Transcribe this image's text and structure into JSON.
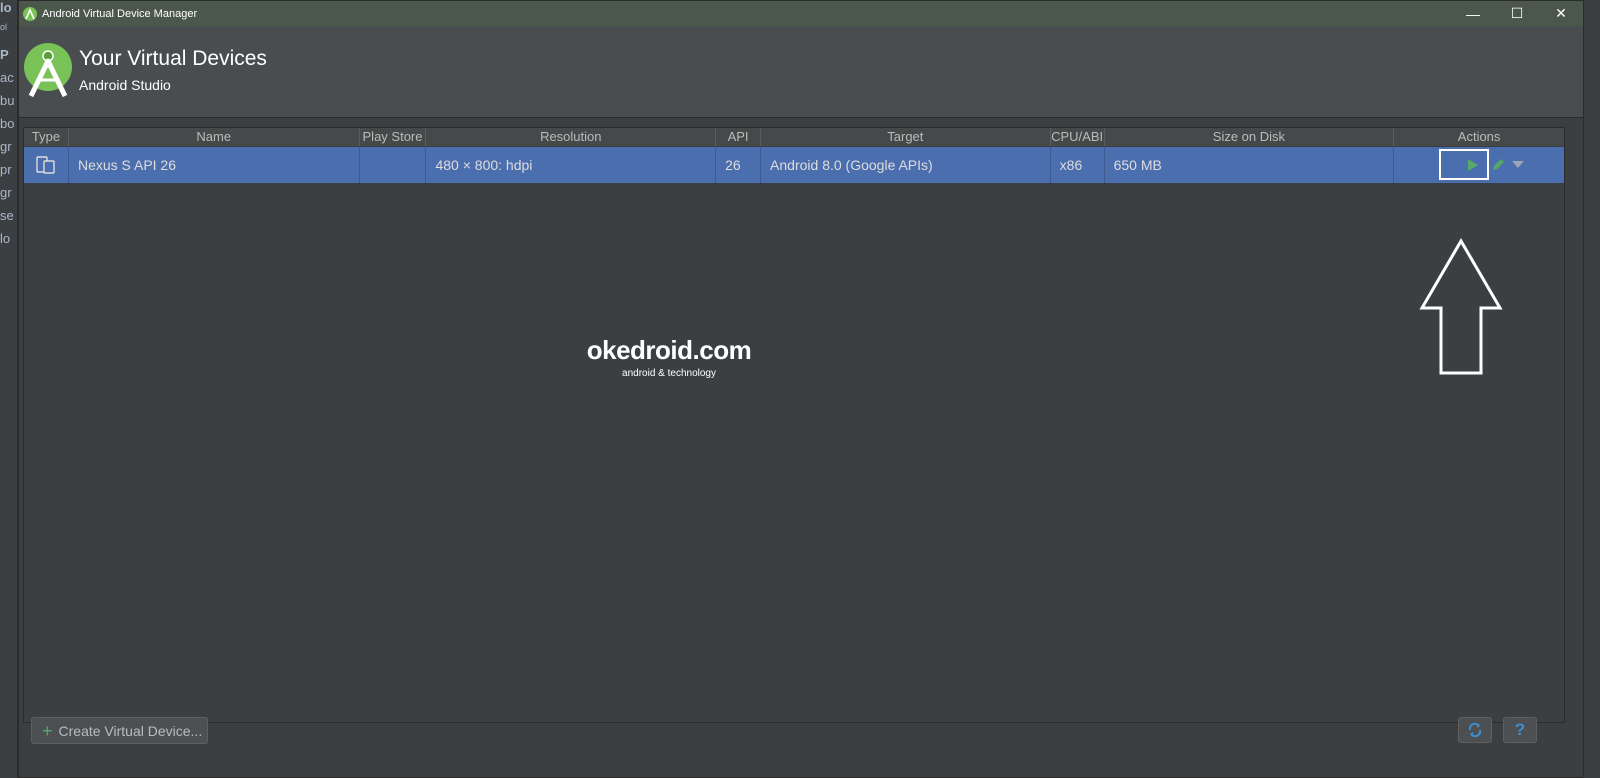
{
  "window": {
    "title": "Android Virtual Device Manager",
    "controls": {
      "minimize": "—",
      "maximize": "☐",
      "close": "✕"
    }
  },
  "background_ide": {
    "fragments": [
      "lo",
      "ol",
      "P",
      "ac",
      "bu",
      "bo",
      "gr",
      "pr",
      "gr",
      "se",
      "lo"
    ]
  },
  "header": {
    "title": "Your Virtual Devices",
    "subtitle": "Android Studio",
    "logo_icon": "android-studio-logo-icon"
  },
  "table": {
    "columns": [
      "Type",
      "Name",
      "Play Store",
      "Resolution",
      "API",
      "Target",
      "CPU/ABI",
      "Size on Disk",
      "Actions"
    ],
    "rows": [
      {
        "type_icon": "phone-tablet-icon",
        "name": "Nexus S API 26",
        "play_store": "",
        "resolution": "480 × 800: hdpi",
        "api": "26",
        "target": "Android 8.0 (Google APIs)",
        "cpu_abi": "x86",
        "size_on_disk": "650 MB",
        "actions": [
          "play-icon",
          "pencil-icon",
          "dropdown-icon"
        ]
      }
    ]
  },
  "watermark": {
    "main": "okedroid.com",
    "sub": "android & technology"
  },
  "footer": {
    "create_label": "Create Virtual Device...",
    "refresh_icon": "refresh-icon",
    "help_label": "?"
  },
  "colors": {
    "selection": "#4b6eaf",
    "titlebar": "#4b574b",
    "background": "#3c3f41",
    "accent_green": "#59a869"
  }
}
